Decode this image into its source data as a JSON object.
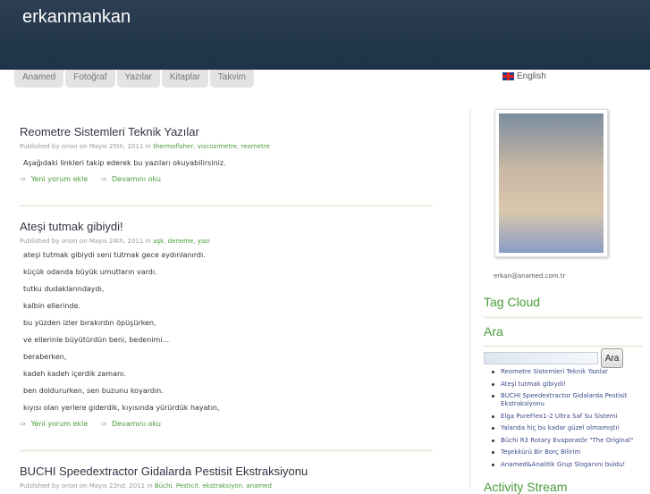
{
  "site": {
    "title": "erkanmankan"
  },
  "nav": [
    {
      "label": "Anamed"
    },
    {
      "label": "Fotoğraf"
    },
    {
      "label": "Yazılar"
    },
    {
      "label": "Kitaplar"
    },
    {
      "label": "Takvim"
    }
  ],
  "language": {
    "label": "English"
  },
  "posts": [
    {
      "title": "Reometre Sistemleri Teknik Yazılar",
      "meta": "Published by orion on Mayıs 25th, 2011 in",
      "tags": [
        "thermofisher",
        "viscozimetre",
        "reometre"
      ],
      "body": [
        "Aşağıdaki linkleri takip ederek bu yazıları okuyabilirsiniz."
      ],
      "comment": "Yeni yorum ekle",
      "more": "Devamını oku"
    },
    {
      "title": "Ateşi tutmak gibiydi!",
      "meta": "Published by orion on Mayıs 24th, 2011 in",
      "tags": [
        "aşk",
        "deneme",
        "yazı"
      ],
      "body": [
        "ateşi tutmak gibiydi seni tutmak gece aydınlanırdı.",
        "küçük odanda büyük umutların vardı.",
        "tutku dudaklarındaydı,",
        "kalbin ellerinde.",
        "bu yüzden izler bırakırdın öpüşürken,",
        "ve ellerinle büyütürdün beni, bedenimi...",
        "beraberken,",
        "kadeh kadeh içerdik zamanı.",
        "ben doldururken, sen buzunu koyardın.",
        "kıyısı olan yerlere giderdik, kıyısında yürürdük hayatın,"
      ],
      "comment": "Yeni yorum ekle",
      "more": "Devamını oku"
    },
    {
      "title": "BUCHI Speedextractor Gidalarda Pestisit Ekstraksiyonu",
      "meta": "Published by orion on Mayıs 22nd, 2011 in",
      "tags": [
        "Büchi",
        "Pesticit",
        "ekstraksiyon",
        "anamed"
      ]
    }
  ],
  "sidebar": {
    "email": "erkan@anamed.com.tr",
    "tag_cloud": "Tag Cloud",
    "search_heading": "Ara",
    "search_value": "",
    "search_button": "Ara",
    "recent": [
      "Reometre Sistemleri Teknik Yazılar",
      "Ateşi tutmak gibiydi!",
      "BUCHI Speedextractor Gidalarda Pestisit Ekstraksiyonu",
      "Elga PureFlex1-2 Ultra Saf Su Sistemi",
      "Yalanda hiç bu kadar güzel olmamıştı!",
      "Büchi R3 Rotary Evaporatör \"The Original\"",
      "Teşekkürü Bir Borç Bilirim",
      "Anamed&Analitik Grup Sloganını buldu!"
    ],
    "activity": "Activity Stream"
  }
}
